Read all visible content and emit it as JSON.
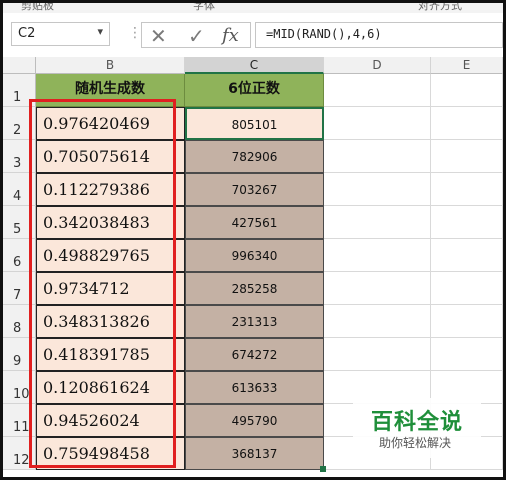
{
  "ribbon": {
    "items": [
      "剪贴板",
      "字体",
      "对齐方式"
    ]
  },
  "formula_bar": {
    "name_box": "C2",
    "cancel_icon": "close-icon",
    "enter_icon": "check-icon",
    "fx_label": "fx",
    "formula": "=MID(RAND(),4,6)"
  },
  "columns": [
    "B",
    "C",
    "D",
    "E"
  ],
  "rows": [
    "1",
    "2",
    "3",
    "4",
    "5",
    "6",
    "7",
    "8",
    "9",
    "10",
    "11",
    "12"
  ],
  "headers": {
    "b": "随机生成数",
    "c": "6位正数"
  },
  "table": [
    {
      "b": "0.976420469",
      "c": "805101"
    },
    {
      "b": "0.705075614",
      "c": "782906"
    },
    {
      "b": "0.112279386",
      "c": "703267"
    },
    {
      "b": "0.342038483",
      "c": "427561"
    },
    {
      "b": "0.498829765",
      "c": "996340"
    },
    {
      "b": "0.9734712",
      "c": "285258"
    },
    {
      "b": "0.348313826",
      "c": "231313"
    },
    {
      "b": "0.418391785",
      "c": "674272"
    },
    {
      "b": "0.120861624",
      "c": "613633"
    },
    {
      "b": "0.94526024",
      "c": "495790"
    },
    {
      "b": "0.759498458",
      "c": "368137"
    }
  ],
  "watermark": {
    "title": "百科全说",
    "subtitle": "助你轻松解决"
  },
  "colors": {
    "header_green": "#8fb35a",
    "b_fill": "#fbe7da",
    "c_fill": "#c4b1a4",
    "highlight_red": "#e02020",
    "selection_green": "#217346"
  }
}
